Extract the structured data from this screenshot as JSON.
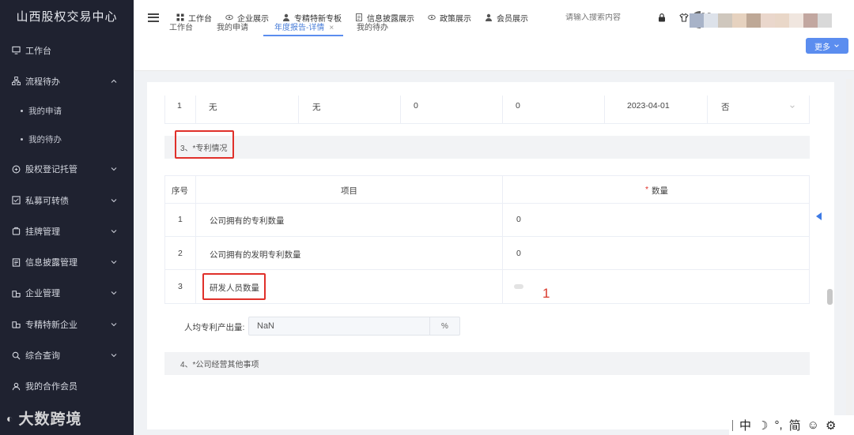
{
  "sidebar": {
    "brand": "山西股权交易中心",
    "items": [
      {
        "label": "工作台",
        "icon": "monitor-icon",
        "chevron": false
      },
      {
        "label": "流程待办",
        "icon": "flow-icon",
        "chevron": "up"
      },
      {
        "label": "股权登记托管",
        "icon": "registry-icon",
        "chevron": "down"
      },
      {
        "label": "私募可转债",
        "icon": "bond-icon",
        "chevron": "down"
      },
      {
        "label": "挂牌管理",
        "icon": "listing-icon",
        "chevron": "down"
      },
      {
        "label": "信息披露管理",
        "icon": "disclosure-icon",
        "chevron": "down"
      },
      {
        "label": "企业管理",
        "icon": "company-icon",
        "chevron": "down"
      },
      {
        "label": "专精特新企业",
        "icon": "enterprise-icon",
        "chevron": "down"
      },
      {
        "label": "综合查询",
        "icon": "search-icon",
        "chevron": "down"
      },
      {
        "label": "我的合作会员",
        "icon": "member-icon",
        "chevron": false
      }
    ],
    "sub_items": [
      "我的申请",
      "我的待办"
    ],
    "watermark": "大数跨境"
  },
  "topbar": {
    "nav": [
      {
        "label": "工作台",
        "icon": "grid-icon"
      },
      {
        "label": "企业展示",
        "icon": "eye-icon"
      },
      {
        "label": "专精特新专板",
        "icon": "user-icon"
      },
      {
        "label": "信息披露展示",
        "icon": "doc-icon"
      },
      {
        "label": "政策展示",
        "icon": "eye-icon"
      },
      {
        "label": "会员展示",
        "icon": "user-icon"
      }
    ],
    "search_placeholder": "请输入搜索内容",
    "avatar_colors": [
      "#a8b3c8",
      "#dde2ea",
      "#cfc7bd",
      "#e6d2bf",
      "#bea896",
      "#ead7cc",
      "#e9d7c8",
      "#f0e6df",
      "#c2a7a0",
      "#d9d9d9"
    ]
  },
  "tabs": [
    {
      "label": "工作台",
      "closable": false,
      "active": false
    },
    {
      "label": "我的申请",
      "closable": false,
      "active": false
    },
    {
      "label": "年度报告-详情",
      "closable": true,
      "active": true
    },
    {
      "label": "我的待办",
      "closable": false,
      "active": false
    }
  ],
  "more_button": "更多",
  "prev_row": {
    "index": "1",
    "c1": "无",
    "c2": "无",
    "c3": "0",
    "c4": "0",
    "date": "2023-04-01",
    "flag": "否"
  },
  "patent_section": {
    "title": "3、*专利情况",
    "headers": {
      "index": "序号",
      "item": "项目",
      "qty_star": "*",
      "qty": "数量"
    },
    "rows": [
      {
        "index": "1",
        "item": "公司拥有的专利数量",
        "qty": "0"
      },
      {
        "index": "2",
        "item": "公司拥有的发明专利数量",
        "qty": "0"
      },
      {
        "index": "3",
        "item": "研发人员数量",
        "qty": ""
      }
    ],
    "annotation": "1",
    "ratio_label": "人均专利产出量:",
    "ratio_value": "NaN",
    "ratio_unit": "%"
  },
  "next_section": {
    "title": "4、*公司经营其他事项"
  },
  "ime": {
    "lang": "中",
    "moon": "☽",
    "punct": "°,",
    "simp": "简",
    "emoji": "☺",
    "gear": "⚙"
  },
  "colors": {
    "accent": "#5b8def",
    "sidebar_bg": "#1f2230",
    "annotation": "#e0302a"
  }
}
